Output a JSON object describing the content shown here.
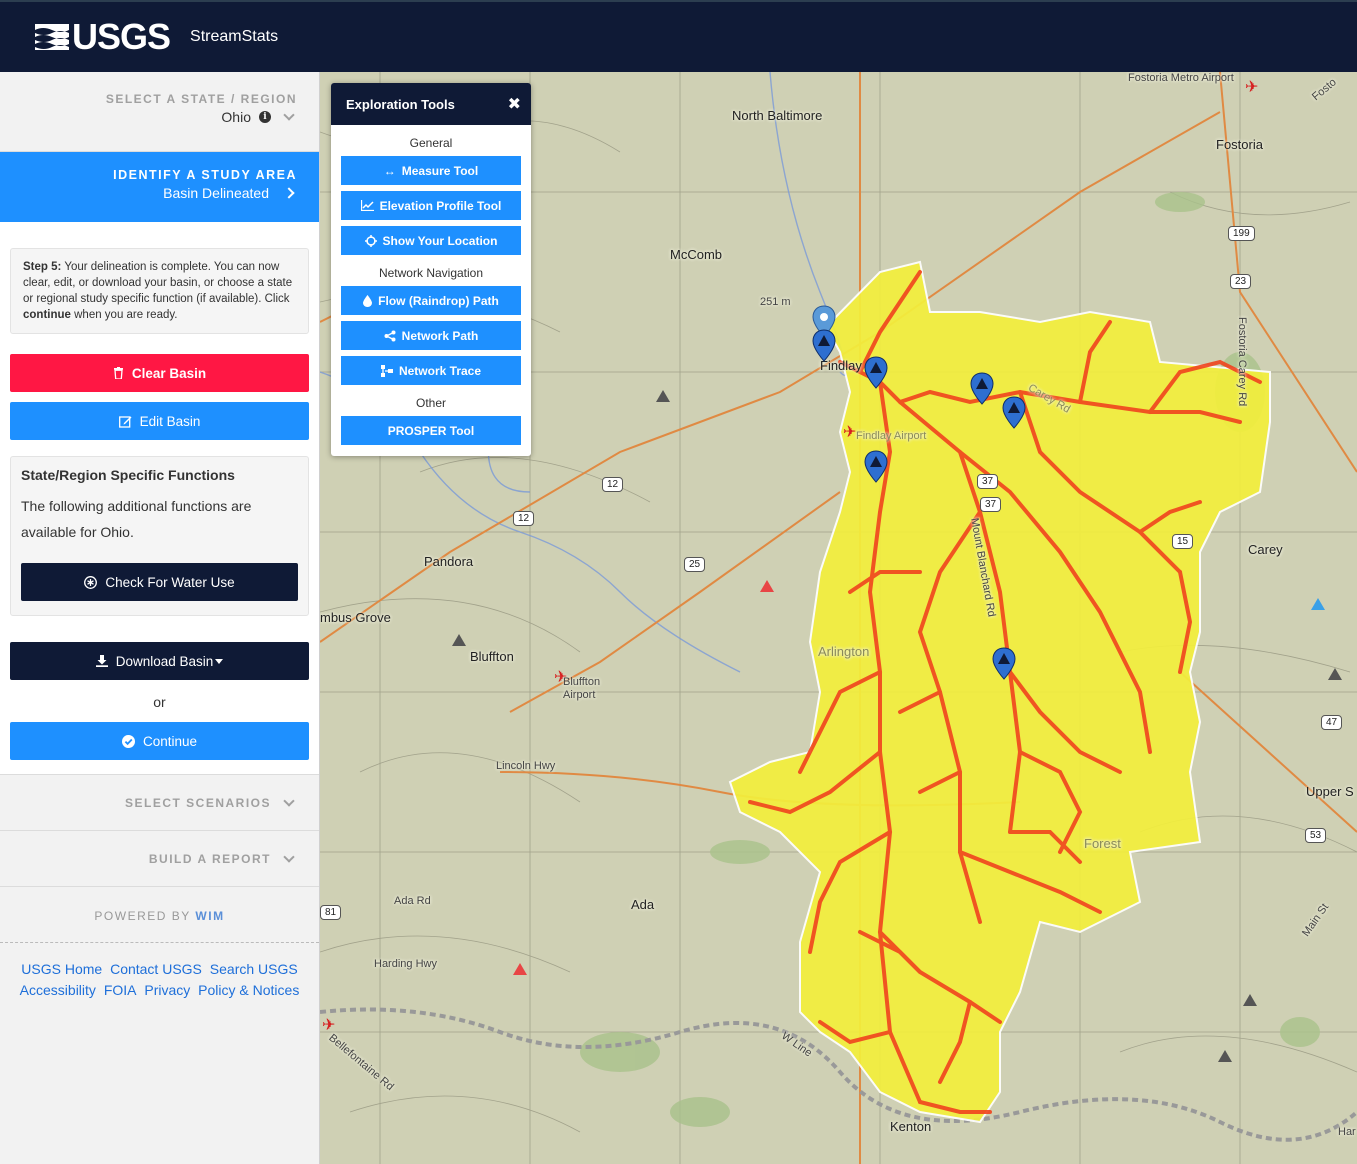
{
  "header": {
    "logo_text": "USGS",
    "app_name": "StreamStats"
  },
  "sidebar": {
    "select_state": {
      "caption": "SELECT A STATE / REGION",
      "value": "Ohio"
    },
    "identify": {
      "caption": "IDENTIFY A STUDY AREA",
      "value": "Basin Delineated"
    },
    "step5": {
      "bold": "Step 5:",
      "text_part1": " Your delineation is complete. You can now clear, edit, or download your basin, or choose a state or regional study specific function (if available). Click ",
      "bold2": "continue",
      "text_part2": " when you are ready."
    },
    "clear_label": "Clear Basin",
    "edit_label": "Edit Basin",
    "functions": {
      "title": "State/Region Specific Functions",
      "text": "The following additional functions are available for Ohio.",
      "water_use_label": "Check For Water Use"
    },
    "download_label": "Download Basin",
    "or_text": "or",
    "continue_label": "Continue",
    "select_scenarios": "SELECT SCENARIOS",
    "build_report": "BUILD A REPORT",
    "powered_by": "POWERED BY",
    "powered_wim": "WIM",
    "footer_links": [
      "USGS Home",
      "Contact USGS",
      "Search USGS",
      "Accessibility",
      "FOIA",
      "Privacy",
      "Policy & Notices"
    ]
  },
  "tools": {
    "title": "Exploration Tools",
    "section_general": "General",
    "measure": "Measure Tool",
    "elevation": "Elevation Profile Tool",
    "location": "Show Your Location",
    "section_network": "Network Navigation",
    "flow": "Flow (Raindrop) Path",
    "network_path": "Network Path",
    "network_trace": "Network Trace",
    "section_other": "Other",
    "prosper": "PROSPER Tool"
  },
  "map": {
    "labels": {
      "north_baltimore": "North Baltimore",
      "fostoria_airport": "Fostoria Metro Airport",
      "fostoria": "Fostoria",
      "mccomb": "McComb",
      "elev": "251 m",
      "findlay": "Findlay",
      "findlay_airport": "Findlay Airport",
      "pandora": "Pandora",
      "columbus_grove": "mbus Grove",
      "bluffton": "Bluffton",
      "bluffton_airport": "Bluffton Airport",
      "ada_city": "Ada",
      "arlington": "Arlington",
      "carey": "Carey",
      "upper_s": "Upper S",
      "forest": "Forest",
      "lincoln_hwy": "Lincoln Hwy",
      "ada_rd": "Ada Rd",
      "harding_hwy": "Harding Hwy",
      "bellefontaine_rd": "Bellefontaine Rd",
      "w_line": "W Line",
      "kenton": "Kenton",
      "mount_blanchard_rd": "Mount Blanchard Rd",
      "fostoria_carey_rd": "Fostoria Carey Rd",
      "main_st": "Main St",
      "fostoria_road": "Fosto",
      "carey_rd": "Carey Rd",
      "hardin": "Har"
    },
    "shields": [
      "199",
      "23",
      "12",
      "12",
      "25",
      "37",
      "37",
      "15",
      "47",
      "53",
      "81"
    ]
  }
}
